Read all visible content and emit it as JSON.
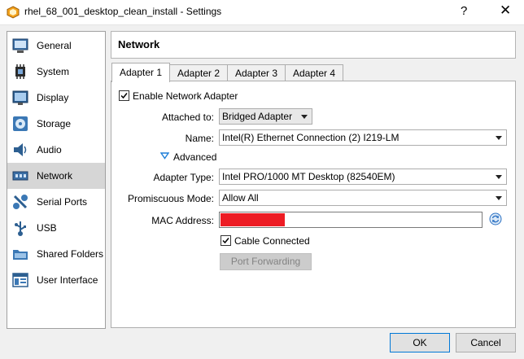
{
  "window": {
    "title": "rhel_68_001_desktop_clean_install - Settings",
    "help": "?",
    "close": "✕"
  },
  "sidebar": {
    "items": [
      {
        "label": "General",
        "icon": "general-icon"
      },
      {
        "label": "System",
        "icon": "system-icon"
      },
      {
        "label": "Display",
        "icon": "display-icon"
      },
      {
        "label": "Storage",
        "icon": "storage-icon"
      },
      {
        "label": "Audio",
        "icon": "audio-icon"
      },
      {
        "label": "Network",
        "icon": "network-icon",
        "active": true
      },
      {
        "label": "Serial Ports",
        "icon": "serial-ports-icon"
      },
      {
        "label": "USB",
        "icon": "usb-icon"
      },
      {
        "label": "Shared Folders",
        "icon": "shared-folders-icon"
      },
      {
        "label": "User Interface",
        "icon": "user-interface-icon"
      }
    ]
  },
  "header": {
    "title": "Network"
  },
  "tabs": [
    {
      "label": "Adapter 1",
      "active": true
    },
    {
      "label": "Adapter 2"
    },
    {
      "label": "Adapter 3"
    },
    {
      "label": "Adapter 4"
    }
  ],
  "form": {
    "enable_adapter": {
      "label": "Enable Network Adapter",
      "checked": true
    },
    "attached_to": {
      "label": "Attached to:",
      "value": "Bridged Adapter"
    },
    "name": {
      "label": "Name:",
      "value": "Intel(R) Ethernet Connection (2) I219-LM"
    },
    "advanced": {
      "label": "Advanced"
    },
    "adapter_type": {
      "label": "Adapter Type:",
      "value": "Intel PRO/1000 MT Desktop (82540EM)"
    },
    "promiscuous_mode": {
      "label": "Promiscuous Mode:",
      "value": "Allow All"
    },
    "mac_address": {
      "label": "MAC Address:",
      "value": ""
    },
    "cable_connected": {
      "label": "Cable Connected",
      "checked": true
    },
    "port_forwarding": {
      "label": "Port Forwarding"
    }
  },
  "footer": {
    "ok": "OK",
    "cancel": "Cancel"
  },
  "colors": {
    "accent": "#0078d7",
    "redaction": "#ed1c24",
    "selected": "#d6d6d6"
  }
}
